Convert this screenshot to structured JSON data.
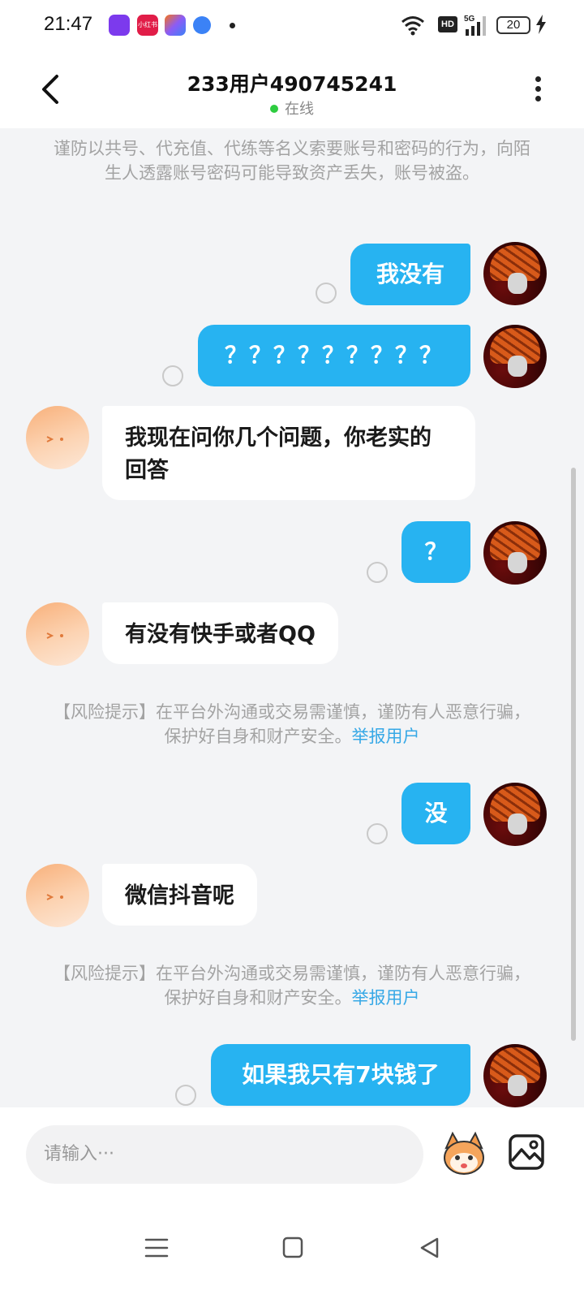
{
  "status_bar": {
    "time": "21:47",
    "app_icon_label": "小红书",
    "network": "HD",
    "signal": "5G",
    "battery": "20"
  },
  "header": {
    "title": "233用户490745241",
    "status": "在线"
  },
  "security_notice": "谨防以共号、代充值、代练等名义索要账号和密码的行为，向陌生人透露账号密码可能导致资产丢失，账号被盗。",
  "risk_notice": {
    "text": "【风险提示】在平台外沟通或交易需谨慎，谨防有人恶意行骗，保护好自身和财产安全。",
    "link": "举报用户"
  },
  "messages": [
    {
      "from": "me",
      "text": "我没有"
    },
    {
      "from": "me",
      "text": "？？？？？？？？？"
    },
    {
      "from": "other",
      "text": "我现在问你几个问题，你老实的回答"
    },
    {
      "from": "me",
      "text": "？"
    },
    {
      "from": "other",
      "text": "有没有快手或者QQ"
    },
    {
      "from": "me",
      "text": "没"
    },
    {
      "from": "other",
      "text": "微信抖音呢"
    },
    {
      "from": "me",
      "text": "如果我只有7块钱了"
    }
  ],
  "input": {
    "placeholder": "请输入···"
  },
  "colors": {
    "bubble_out": "#27b3f1",
    "link": "#36a8e6",
    "online": "#2ecc40"
  }
}
